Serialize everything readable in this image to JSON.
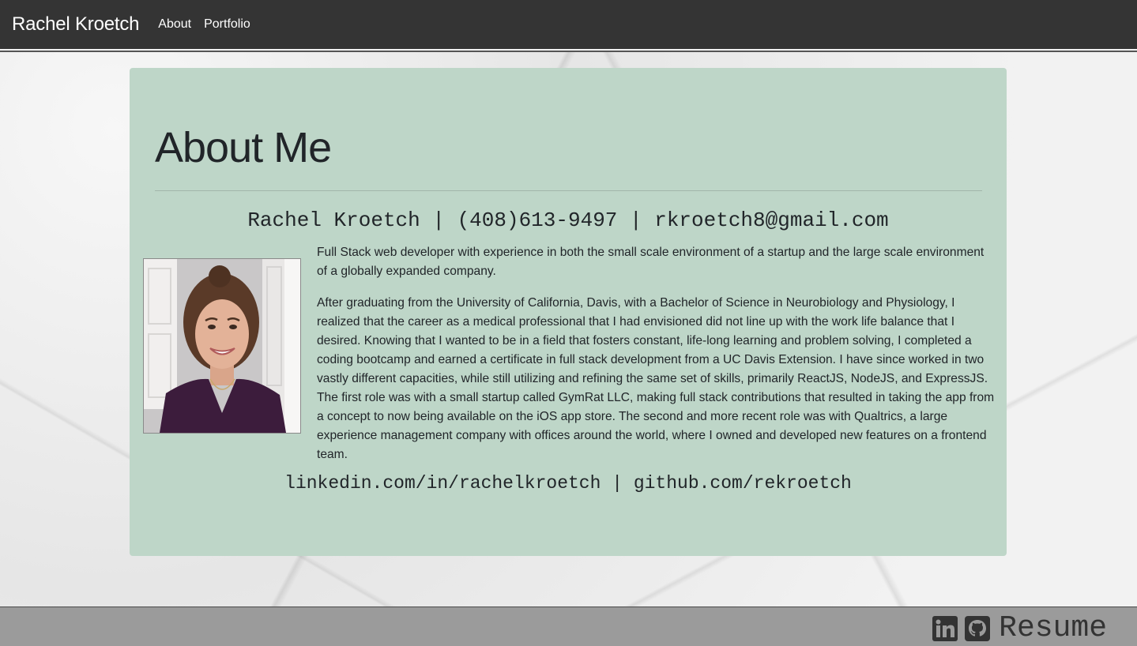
{
  "navbar": {
    "brand": "Rachel Kroetch",
    "links": [
      "About",
      "Portfolio"
    ]
  },
  "about": {
    "title": "About Me",
    "contact": "Rachel Kroetch | (408)613-9497 | rkroetch8@gmail.com",
    "photo_icon": "profile-photo",
    "paragraphs": [
      "Full Stack web developer with experience in both the small scale environment of a startup and the large scale environment of a globally expanded company.",
      "After graduating from the University of California, Davis, with a Bachelor of Science in Neurobiology and Physiology, I realized that the career as a medical professional that I had envisioned did not line up with the work life balance that I desired. Knowing that I wanted to be in a field that fosters constant, life-long learning and problem solving, I completed a coding bootcamp and earned a certificate in full stack development from a UC Davis Extension. I have since worked in two vastly different capacities, while still utilizing and refining the same set of skills, primarily ReactJS, NodeJS, and ExpressJS. The first role was with a small startup called GymRat LLC, making full stack contributions that resulted in taking the app from a concept to now being available on the iOS app store. The second and more recent role was with Qualtrics, a large experience management company with offices around the world, where I owned and developed new features on a frontend team."
    ],
    "links": "linkedin.com/in/rachelkroetch | github.com/rekroetch"
  },
  "footer": {
    "icons": [
      "linkedin-icon",
      "github-icon"
    ],
    "resume_label": "Resume"
  },
  "colors": {
    "navbar_bg": "#343434",
    "card_bg": "#bed6c8",
    "footer_bg": "#9b9b9b",
    "text": "#212529"
  }
}
